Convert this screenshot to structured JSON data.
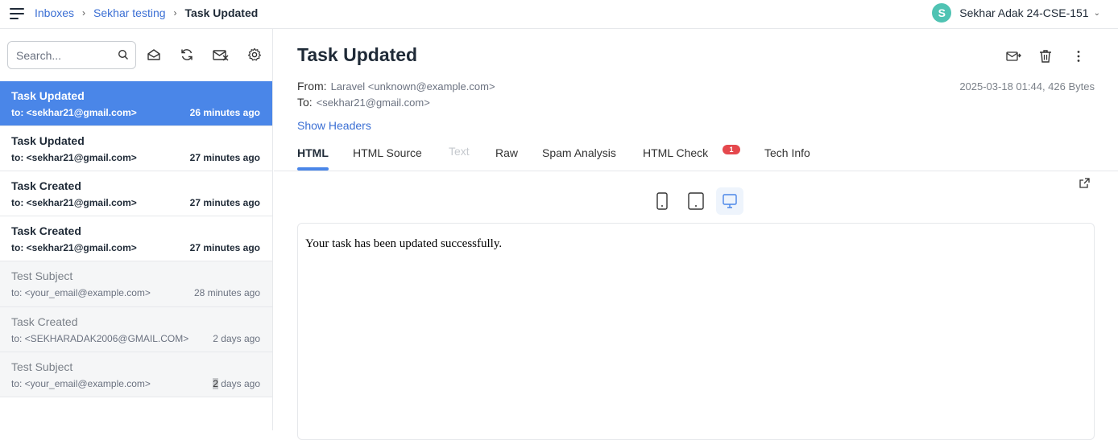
{
  "breadcrumb": {
    "inboxes": "Inboxes",
    "inbox": "Sekhar testing",
    "current": "Task Updated",
    "separator": "›"
  },
  "user": {
    "initial": "S",
    "name": "Sekhar Adak 24-CSE-151",
    "avatar_color": "#4fc3b3",
    "chevron": "⌄"
  },
  "search": {
    "placeholder": "Search..."
  },
  "toolbar_icons": [
    "envelope-open-icon",
    "refresh-icon",
    "mark-read-icon",
    "gear-icon"
  ],
  "messages": [
    {
      "subject": "Task Updated",
      "to": "to: <sekhar21@gmail.com>",
      "time": "26 minutes ago",
      "state": "active"
    },
    {
      "subject": "Task Updated",
      "to": "to: <sekhar21@gmail.com>",
      "time": "27 minutes ago",
      "state": "unread"
    },
    {
      "subject": "Task Created",
      "to": "to: <sekhar21@gmail.com>",
      "time": "27 minutes ago",
      "state": "unread"
    },
    {
      "subject": "Task Created",
      "to": "to: <sekhar21@gmail.com>",
      "time": "27 minutes ago",
      "state": "unread"
    },
    {
      "subject": "Test Subject",
      "to": "to: <your_email@example.com>",
      "time": "28 minutes ago",
      "state": "read"
    },
    {
      "subject": "Task Created",
      "to": "to: <SEKHARADAK2006@GMAIL.COM>",
      "time": "2 days ago",
      "state": "read"
    },
    {
      "subject": "Test Subject",
      "to": "to: <your_email@example.com>",
      "time_highlight": "2",
      "time_rest": " days ago",
      "state": "read"
    }
  ],
  "email": {
    "title": "Task Updated",
    "from_label": "From:",
    "from_value": "Laravel <unknown@example.com>",
    "to_label": "To:",
    "to_value": "<sekhar21@gmail.com>",
    "meta": "2025-03-18 01:44, 426 Bytes",
    "show_headers": "Show Headers",
    "body": "Your task has been updated successfully."
  },
  "tabs": {
    "html": "HTML",
    "html_source": "HTML Source",
    "text": "Text",
    "raw": "Raw",
    "spam": "Spam Analysis",
    "html_check": "HTML Check",
    "html_check_badge": "1",
    "tech_info": "Tech Info"
  },
  "colors": {
    "accent": "#4a86e8",
    "link": "#3b6fd4",
    "badge": "#e5484d"
  }
}
